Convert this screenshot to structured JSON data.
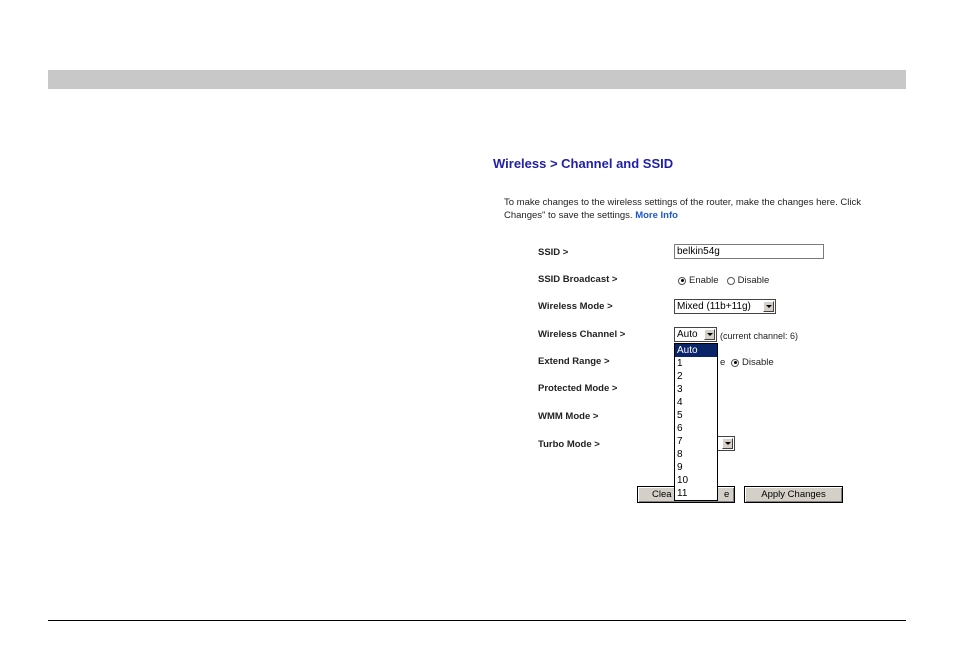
{
  "page": {
    "title": "Wireless > Channel and SSID",
    "description": {
      "line1": "To make changes to the wireless settings of the router, make the changes here. Click",
      "line2": "Changes\" to save the settings.",
      "more_info": "More Info"
    }
  },
  "form": {
    "ssid": {
      "label": "SSID >",
      "value": "belkin54g"
    },
    "ssid_broadcast": {
      "label": "SSID Broadcast >",
      "options": [
        "Enable",
        "Disable"
      ],
      "selected": "Enable"
    },
    "wireless_mode": {
      "label": "Wireless Mode >",
      "value": "Mixed (11b+11g)"
    },
    "wireless_channel": {
      "label": "Wireless Channel >",
      "value": "Auto",
      "note": "(current channel: 6)"
    },
    "extend_range": {
      "label": "Extend Range >",
      "partial_option": "e",
      "disable_label": "Disable",
      "selected": "Disable"
    },
    "protected_mode": {
      "label": "Protected Mode >"
    },
    "wmm_mode": {
      "label": "WMM Mode >"
    },
    "turbo_mode": {
      "label": "Turbo Mode >"
    }
  },
  "buttons": {
    "clear_left": "Clea",
    "clear_right": "e",
    "apply": "Apply Changes"
  },
  "channel_dropdown": {
    "options": [
      "Auto",
      "1",
      "2",
      "3",
      "4",
      "5",
      "6",
      "7",
      "8",
      "9",
      "10",
      "11"
    ],
    "selected": "Auto"
  },
  "colors": {
    "title": "#1f1fa8",
    "link": "#1f57c8",
    "selection": "#0a246a",
    "header_bar": "#c8c8c8"
  }
}
